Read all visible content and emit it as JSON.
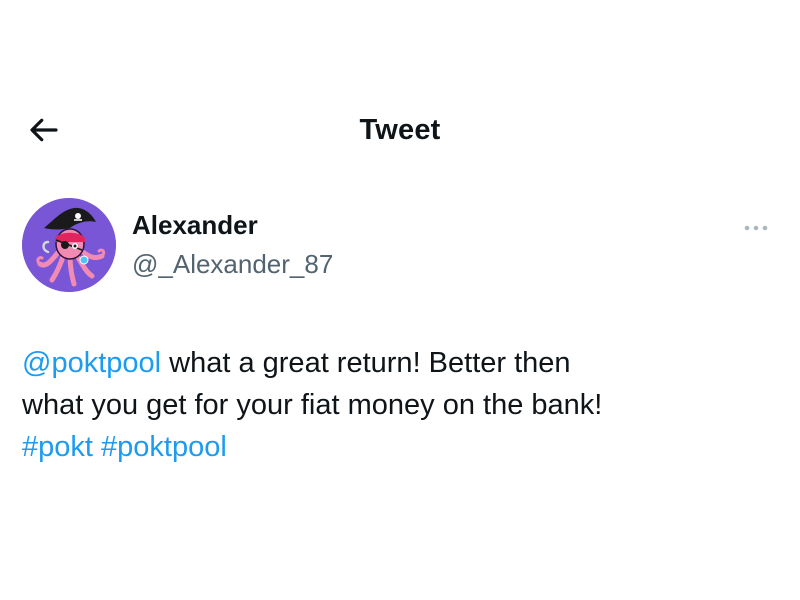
{
  "header": {
    "back_icon": "arrow-left-icon",
    "title": "Tweet"
  },
  "author": {
    "avatar_icon": "pirate-octopus-avatar",
    "display_name": "Alexander",
    "handle": "@_Alexander_87",
    "more_icon": "more-horizontal-icon"
  },
  "tweet": {
    "mention": "@poktpool",
    "text_line1": " what a great return! Better then",
    "text_line2": "what you get for your fiat money on the bank!",
    "hashtag1": "#pokt",
    "hashtag2": "#poktpool"
  },
  "colors": {
    "link": "#1d9bf0",
    "text": "#0f1419",
    "secondary": "#536471",
    "avatar_bg": "#7856d6"
  }
}
